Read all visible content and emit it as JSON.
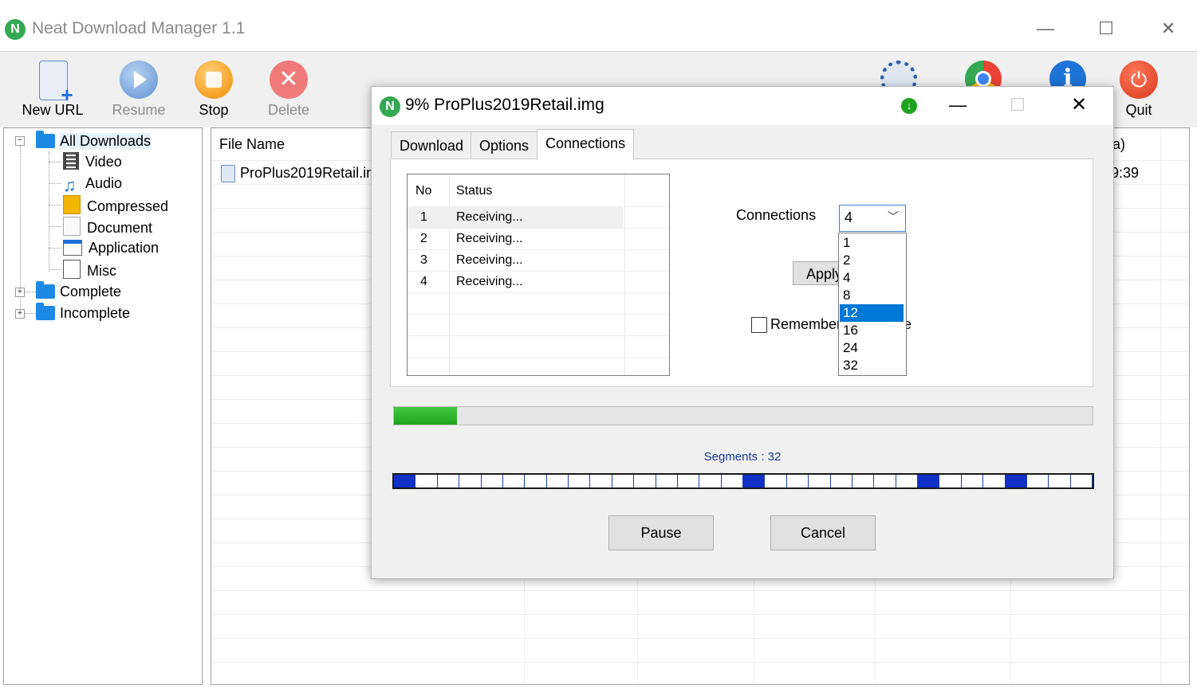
{
  "window": {
    "title": "Neat Download Manager 1.1",
    "minimize_glyph": "—",
    "maximize_glyph": "☐",
    "close_glyph": "✕"
  },
  "toolbar": {
    "new_url": "New URL",
    "resume": "Resume",
    "stop": "Stop",
    "delete": "Delete",
    "quit": "Quit"
  },
  "tree": {
    "root": "All Downloads",
    "children": [
      "Video",
      "Audio",
      "Compressed",
      "Document",
      "Application",
      "Misc"
    ],
    "complete": "Complete",
    "incomplete": "Incomplete"
  },
  "list": {
    "column_file_name": "File Name",
    "column_partial": "a)",
    "row_file": "ProPlus2019Retail.in",
    "row_time_partial": "9:39"
  },
  "dialog": {
    "title": "9%  ProPlus2019Retail.img",
    "minimize_glyph": "—",
    "maximize_glyph": "☐",
    "close_glyph": "✕",
    "tabs": [
      "Download",
      "Options",
      "Connections"
    ],
    "active_tab": "Connections",
    "table": {
      "col_no": "No",
      "col_status": "Status",
      "rows": [
        {
          "no": "1",
          "status": "Receiving..."
        },
        {
          "no": "2",
          "status": "Receiving..."
        },
        {
          "no": "3",
          "status": "Receiving..."
        },
        {
          "no": "4",
          "status": "Receiving..."
        }
      ]
    },
    "connections_label": "Connections",
    "connections_value": "4",
    "connections_options": [
      "1",
      "2",
      "4",
      "8",
      "12",
      "16",
      "24",
      "32"
    ],
    "highlighted_option": "12",
    "apply_label": "Apply",
    "remember_label": "Remember",
    "remember_tail": "e",
    "progress_fraction": 0.09,
    "segments_label": "Segments : 32",
    "segments_active": [
      1,
      17,
      25,
      29
    ],
    "segment_count": 32,
    "pause_label": "Pause",
    "cancel_label": "Cancel"
  },
  "colors": {
    "accent": "#0078d7",
    "progress": "#2db52d",
    "segment": "#1030c8",
    "folder": "#1e88e5"
  }
}
